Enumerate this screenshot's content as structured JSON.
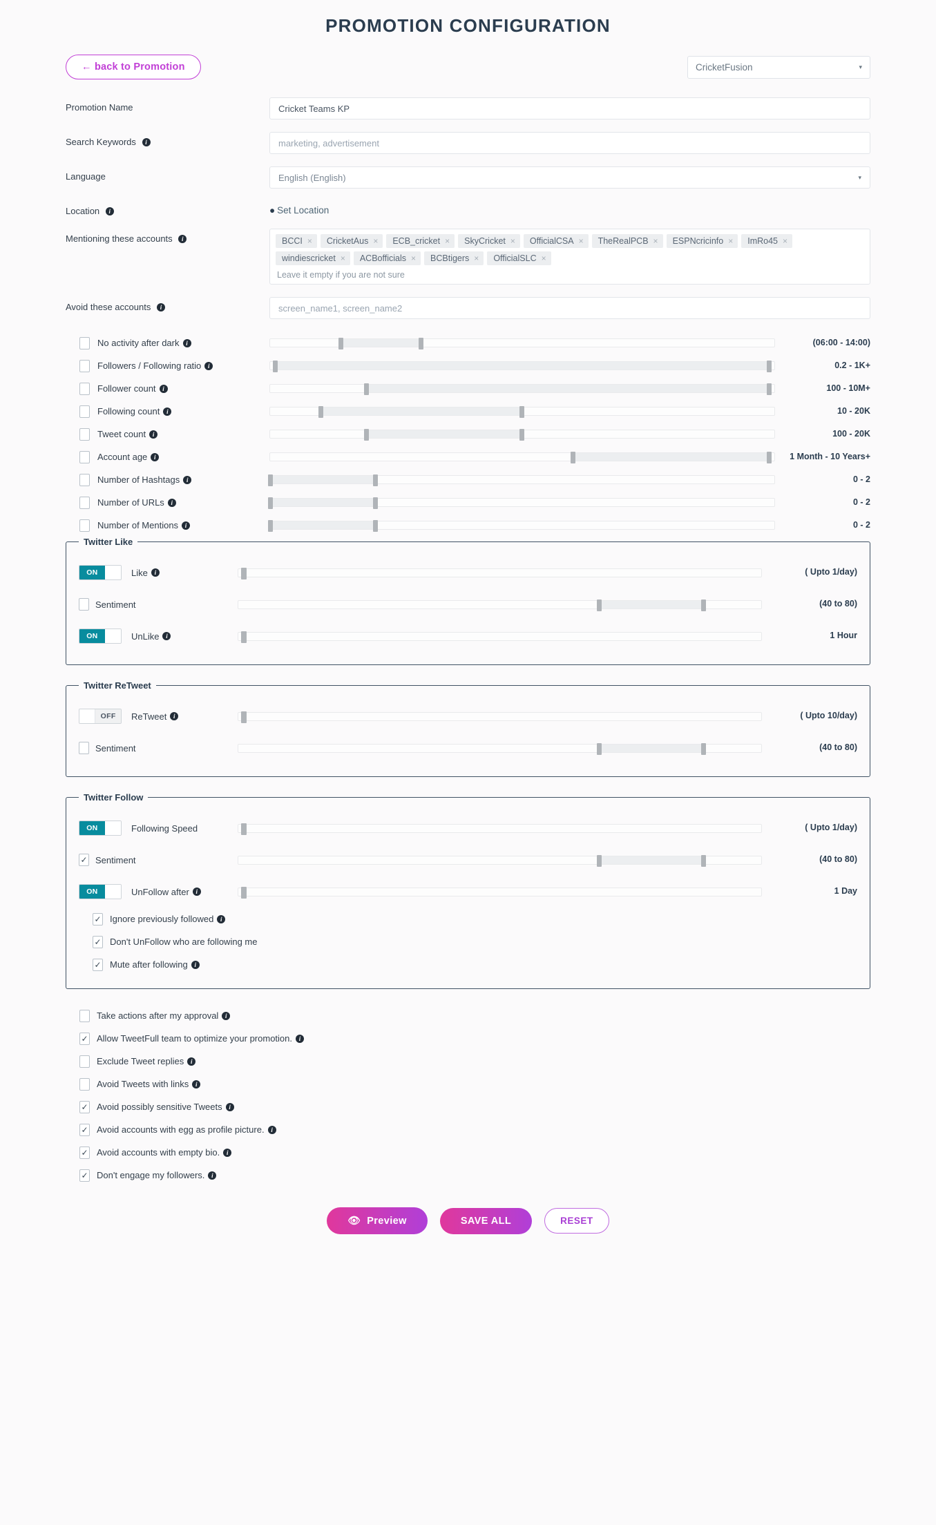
{
  "page_title": "PROMOTION CONFIGURATION",
  "header": {
    "back_button": "back to Promotion",
    "back_arrow": "←",
    "account_select": "CricketFusion",
    "caret": "▾"
  },
  "fields": {
    "promotion_name": {
      "label": "Promotion Name",
      "value": "Cricket Teams KP"
    },
    "search_keywords": {
      "label": "Search Keywords",
      "placeholder": "marketing, advertisement",
      "value": ""
    },
    "language": {
      "label": "Language",
      "value": "English (English)",
      "caret": "▾"
    },
    "location": {
      "label": "Location",
      "action": "Set Location",
      "pin": "📍"
    },
    "mentioning": {
      "label": "Mentioning these accounts",
      "hint": "Leave it empty if you are not sure",
      "tags": [
        "BCCI",
        "CricketAus",
        "ECB_cricket",
        "SkyCricket",
        "OfficialCSA",
        "TheRealPCB",
        "ESPNcricinfo",
        "ImRo45",
        "windiescricket",
        "ACBofficials",
        "BCBtigers",
        "OfficialSLC"
      ],
      "remove_glyph": "×"
    },
    "avoid_accounts": {
      "label": "Avoid these accounts",
      "placeholder": "screen_name1, screen_name2",
      "value": ""
    }
  },
  "filters": [
    {
      "label": "No activity after dark",
      "info": true,
      "checked": false,
      "value": "(06:00 - 14:00)",
      "left_pct": 14,
      "right_pct": 30
    },
    {
      "label": "Followers / Following ratio",
      "info": true,
      "checked": false,
      "value": "0.2 - 1K+",
      "left_pct": 1,
      "right_pct": 99
    },
    {
      "label": "Follower count",
      "info": true,
      "checked": false,
      "value": "100 - 10M+",
      "left_pct": 19,
      "right_pct": 99
    },
    {
      "label": "Following count",
      "info": true,
      "checked": false,
      "value": "10 - 20K",
      "left_pct": 10,
      "right_pct": 50
    },
    {
      "label": "Tweet count",
      "info": true,
      "checked": false,
      "value": "100 - 20K",
      "left_pct": 19,
      "right_pct": 50
    },
    {
      "label": "Account age",
      "info": true,
      "checked": false,
      "value": "1 Month - 10 Years+",
      "left_pct": 60,
      "right_pct": 99
    },
    {
      "label": "Number of Hashtags",
      "info": true,
      "checked": false,
      "value": "0 - 2",
      "left_pct": 0,
      "right_pct": 21
    },
    {
      "label": "Number of URLs",
      "info": true,
      "checked": false,
      "value": "0 - 2",
      "left_pct": 0,
      "right_pct": 21
    },
    {
      "label": "Number of Mentions",
      "info": true,
      "checked": false,
      "value": "0 - 2",
      "left_pct": 0,
      "right_pct": 21
    }
  ],
  "twitter_like": {
    "legend": "Twitter Like",
    "rows": [
      {
        "kind": "toggle",
        "state": "ON",
        "label": "Like",
        "info": true,
        "value": "( Upto 1/day)",
        "left_pct": 1,
        "right_pct": 1
      },
      {
        "kind": "checkbox",
        "checked": false,
        "label": "Sentiment",
        "info": false,
        "value": "(40 to 80)",
        "left_pct": 69,
        "right_pct": 89
      },
      {
        "kind": "toggle",
        "state": "ON",
        "label": "UnLike",
        "info": true,
        "value": "1 Hour",
        "left_pct": 1,
        "right_pct": 1
      }
    ]
  },
  "twitter_retweet": {
    "legend": "Twitter ReTweet",
    "rows": [
      {
        "kind": "toggle",
        "state": "OFF",
        "label": "ReTweet",
        "info": true,
        "value": "( Upto 10/day)",
        "left_pct": 1,
        "right_pct": 1
      },
      {
        "kind": "checkbox",
        "checked": false,
        "label": "Sentiment",
        "info": false,
        "value": "(40 to 80)",
        "left_pct": 69,
        "right_pct": 89
      }
    ]
  },
  "twitter_follow": {
    "legend": "Twitter Follow",
    "rows": [
      {
        "kind": "toggle",
        "state": "ON",
        "label": "Following Speed",
        "info": false,
        "value": "( Upto 1/day)",
        "left_pct": 1,
        "right_pct": 1
      },
      {
        "kind": "checkbox",
        "checked": true,
        "label": "Sentiment",
        "info": false,
        "value": "(40 to 80)",
        "left_pct": 69,
        "right_pct": 89
      },
      {
        "kind": "toggle",
        "state": "ON",
        "label": "UnFollow after",
        "info": true,
        "value": "1 Day",
        "left_pct": 1,
        "right_pct": 1
      }
    ],
    "checks": [
      {
        "label": "Ignore previously followed",
        "info": true,
        "checked": true
      },
      {
        "label": "Don't UnFollow who are following me",
        "info": false,
        "checked": true
      },
      {
        "label": "Mute after following",
        "info": true,
        "checked": true
      }
    ]
  },
  "options": [
    {
      "label": "Take actions after my approval",
      "info": true,
      "checked": false
    },
    {
      "label": "Allow TweetFull team to optimize your promotion.",
      "info": true,
      "checked": true
    },
    {
      "label": "Exclude Tweet replies",
      "info": true,
      "checked": false
    },
    {
      "label": "Avoid Tweets with links",
      "info": true,
      "checked": false
    },
    {
      "label": "Avoid possibly sensitive Tweets",
      "info": true,
      "checked": true
    },
    {
      "label": "Avoid accounts with egg as profile picture.",
      "info": true,
      "checked": true
    },
    {
      "label": "Avoid accounts with empty bio.",
      "info": true,
      "checked": true
    },
    {
      "label": "Don't engage my followers.",
      "info": true,
      "checked": true
    }
  ],
  "buttons": {
    "preview": "Preview",
    "preview_icon": "👁",
    "save": "SAVE ALL",
    "reset": "RESET"
  },
  "colors": {
    "accent_purple": "#c13fd6",
    "toggle_on": "#088c9e",
    "title": "#2b3d4f",
    "grad_from": "#e0389c",
    "grad_to": "#b03fd8"
  }
}
